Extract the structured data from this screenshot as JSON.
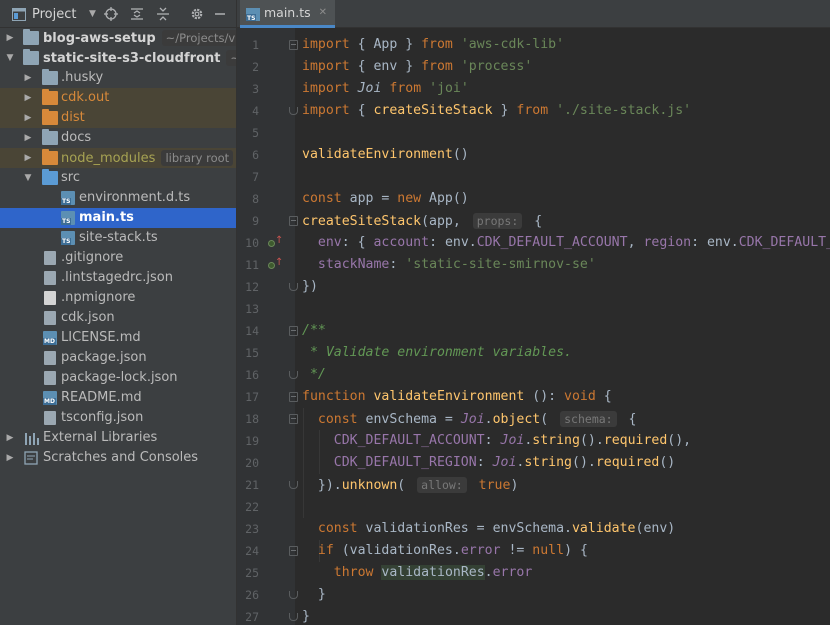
{
  "project_panel": {
    "title": "Project",
    "tree": [
      {
        "label": "blog-aws-setup",
        "hint": "~/Projects/victor",
        "type": "root",
        "expanded": false
      },
      {
        "label": "static-site-s3-cloudfront",
        "hint": "~/Proj",
        "type": "root",
        "expanded": true
      },
      {
        "label": ".husky",
        "type": "folder"
      },
      {
        "label": "cdk.out",
        "type": "folder-excluded"
      },
      {
        "label": "dist",
        "type": "folder-excluded"
      },
      {
        "label": "docs",
        "type": "folder"
      },
      {
        "label": "node_modules",
        "hint": "library root",
        "type": "folder-library"
      },
      {
        "label": "src",
        "type": "folder-source"
      },
      {
        "label": "environment.d.ts",
        "type": "ts"
      },
      {
        "label": "main.ts",
        "type": "ts"
      },
      {
        "label": "site-stack.ts",
        "type": "ts"
      },
      {
        "label": ".gitignore",
        "type": "file"
      },
      {
        "label": ".lintstagedrc.json",
        "type": "file"
      },
      {
        "label": ".npmignore",
        "type": "file"
      },
      {
        "label": "cdk.json",
        "type": "file"
      },
      {
        "label": "LICENSE.md",
        "type": "md"
      },
      {
        "label": "package.json",
        "type": "file"
      },
      {
        "label": "package-lock.json",
        "type": "file"
      },
      {
        "label": "README.md",
        "type": "md"
      },
      {
        "label": "tsconfig.json",
        "type": "file"
      },
      {
        "label": "External Libraries",
        "type": "libs"
      },
      {
        "label": "Scratches and Consoles",
        "type": "scratch"
      }
    ]
  },
  "editor": {
    "tab_label": "main.ts",
    "tab_icon_text": "TS",
    "line_numbers": [
      "1",
      "2",
      "3",
      "4",
      "5",
      "6",
      "7",
      "8",
      "9",
      "10",
      "11",
      "12",
      "13",
      "14",
      "15",
      "16",
      "17",
      "18",
      "19",
      "20",
      "21",
      "22",
      "23",
      "24",
      "25",
      "26",
      "27"
    ],
    "code_lines": [
      "import { App } from 'aws-cdk-lib'",
      "import { env } from 'process'",
      "import Joi from 'joi'",
      "import { createSiteStack } from './site-stack.js'",
      "",
      "validateEnvironment()",
      "",
      "const app = new App()",
      "createSiteStack(app, props: {",
      "  env: { account: env.CDK_DEFAULT_ACCOUNT, region: env.CDK_DEFAULT_REGION },",
      "  stackName: 'static-site-smirnov-se'",
      "})",
      "",
      "/**",
      " * Validate environment variables.",
      " */",
      "function validateEnvironment (): void {",
      "  const envSchema = Joi.object( schema: {",
      "    CDK_DEFAULT_ACCOUNT: Joi.string().required(),",
      "    CDK_DEFAULT_REGION: Joi.string().required()",
      "  }).unknown( allow: true)",
      "",
      "  const validationRes = envSchema.validate(env)",
      "  if (validationRes.error != null) {",
      "    throw validationRes.error",
      "  }",
      "}"
    ],
    "inlay_hints": [
      "props:",
      "schema:",
      "allow:"
    ]
  }
}
